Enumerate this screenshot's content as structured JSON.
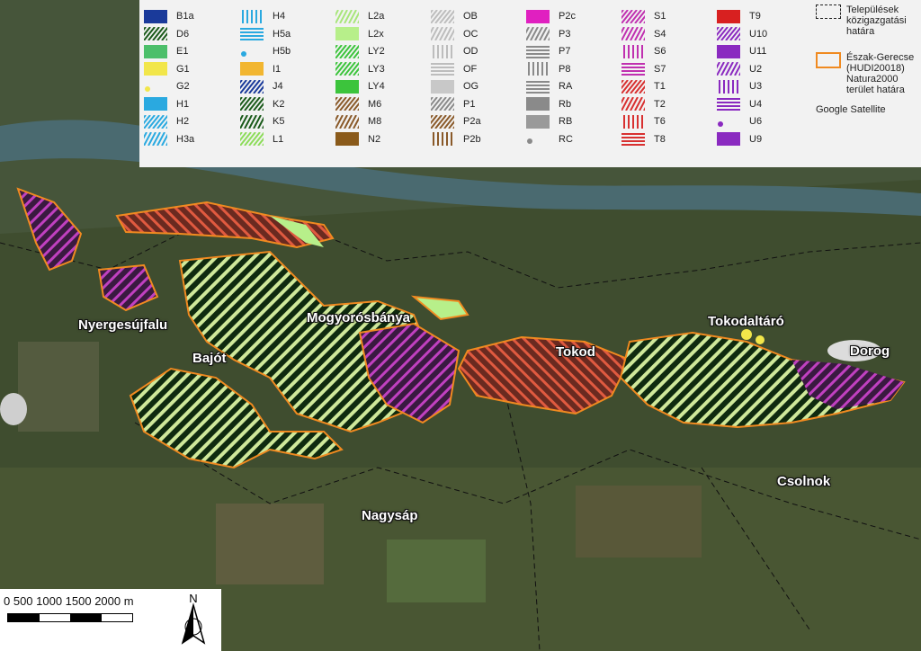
{
  "map": {
    "towns": [
      {
        "name": "Nyergesújfalu"
      },
      {
        "name": "Bajót"
      },
      {
        "name": "Mogyorósbánya"
      },
      {
        "name": "Tokod"
      },
      {
        "name": "Tokodaltáró"
      },
      {
        "name": "Dorog"
      },
      {
        "name": "Csolnok"
      },
      {
        "name": "Nagysáp"
      }
    ]
  },
  "legend": {
    "items": [
      {
        "code": "B1a",
        "fill": "#1a3a9a",
        "pattern": "solid"
      },
      {
        "code": "D6",
        "fill": "#1a5a1a",
        "pattern": "diag"
      },
      {
        "code": "E1",
        "fill": "#4cbf6a",
        "pattern": "solid"
      },
      {
        "code": "G1",
        "fill": "#f2e64a",
        "pattern": "solid"
      },
      {
        "code": "G2",
        "fill": "#f2e64a",
        "pattern": "dot"
      },
      {
        "code": "H1",
        "fill": "#2aa9e0",
        "pattern": "solid"
      },
      {
        "code": "H2",
        "fill": "#2aa9e0",
        "pattern": "diag"
      },
      {
        "code": "H3a",
        "fill": "#2aa9e0",
        "pattern": "diag2"
      },
      {
        "code": "H4",
        "fill": "#2aa9e0",
        "pattern": "vert"
      },
      {
        "code": "H5a",
        "fill": "#2aa9e0",
        "pattern": "horiz"
      },
      {
        "code": "H5b",
        "fill": "#2aa9e0",
        "pattern": "dot"
      },
      {
        "code": "I1",
        "fill": "#f2b630",
        "pattern": "solid"
      },
      {
        "code": "J4",
        "fill": "#1a3a9a",
        "pattern": "diag"
      },
      {
        "code": "K2",
        "fill": "#1a5a1a",
        "pattern": "diag"
      },
      {
        "code": "K5",
        "fill": "#1a5a1a",
        "pattern": "diag2"
      },
      {
        "code": "L1",
        "fill": "#8ddc5a",
        "pattern": "diag"
      },
      {
        "code": "L2a",
        "fill": "#a8e67a",
        "pattern": "diag2"
      },
      {
        "code": "L2x",
        "fill": "#b7ef8a",
        "pattern": "solid"
      },
      {
        "code": "LY2",
        "fill": "#3cc43c",
        "pattern": "diag"
      },
      {
        "code": "LY3",
        "fill": "#3cc43c",
        "pattern": "diag"
      },
      {
        "code": "LY4",
        "fill": "#3cc43c",
        "pattern": "solid"
      },
      {
        "code": "M6",
        "fill": "#8a5a2a",
        "pattern": "diag"
      },
      {
        "code": "M8",
        "fill": "#8a5a2a",
        "pattern": "diag2"
      },
      {
        "code": "N2",
        "fill": "#8a5a1a",
        "pattern": "solid"
      },
      {
        "code": "OB",
        "fill": "#bdbdbd",
        "pattern": "diag"
      },
      {
        "code": "OC",
        "fill": "#bdbdbd",
        "pattern": "diag2"
      },
      {
        "code": "OD",
        "fill": "#bdbdbd",
        "pattern": "vert"
      },
      {
        "code": "OF",
        "fill": "#bdbdbd",
        "pattern": "horiz"
      },
      {
        "code": "OG",
        "fill": "#c8c8c8",
        "pattern": "solid"
      },
      {
        "code": "P1",
        "fill": "#8a8a8a",
        "pattern": "diag"
      },
      {
        "code": "P2a",
        "fill": "#8a5a2a",
        "pattern": "diag"
      },
      {
        "code": "P2b",
        "fill": "#8a5a2a",
        "pattern": "vert"
      },
      {
        "code": "P2c",
        "fill": "#e020c0",
        "pattern": "solid"
      },
      {
        "code": "P3",
        "fill": "#8a8a8a",
        "pattern": "diag2"
      },
      {
        "code": "P7",
        "fill": "#8a8a8a",
        "pattern": "horiz"
      },
      {
        "code": "P8",
        "fill": "#8a8a8a",
        "pattern": "vert"
      },
      {
        "code": "RA",
        "fill": "#8a8a8a",
        "pattern": "horiz"
      },
      {
        "code": "Rb",
        "fill": "#8a8a8a",
        "pattern": "solid"
      },
      {
        "code": "RB",
        "fill": "#9a9a9a",
        "pattern": "solid"
      },
      {
        "code": "RC",
        "fill": "#8a8a8a",
        "pattern": "dot"
      },
      {
        "code": "S1",
        "fill": "#c030b0",
        "pattern": "diag"
      },
      {
        "code": "S4",
        "fill": "#c030b0",
        "pattern": "diag2"
      },
      {
        "code": "S6",
        "fill": "#c030b0",
        "pattern": "vert"
      },
      {
        "code": "S7",
        "fill": "#c030b0",
        "pattern": "horiz"
      },
      {
        "code": "T1",
        "fill": "#d83030",
        "pattern": "diag"
      },
      {
        "code": "T2",
        "fill": "#d83030",
        "pattern": "diag2"
      },
      {
        "code": "T6",
        "fill": "#d83030",
        "pattern": "vert"
      },
      {
        "code": "T8",
        "fill": "#d83030",
        "pattern": "horiz"
      },
      {
        "code": "T9",
        "fill": "#d82020",
        "pattern": "solid"
      },
      {
        "code": "U10",
        "fill": "#8a2ac0",
        "pattern": "diag"
      },
      {
        "code": "U11",
        "fill": "#8a2ac0",
        "pattern": "solid"
      },
      {
        "code": "U2",
        "fill": "#8a2ac0",
        "pattern": "diag2"
      },
      {
        "code": "U3",
        "fill": "#8a2ac0",
        "pattern": "vert"
      },
      {
        "code": "U4",
        "fill": "#8a2ac0",
        "pattern": "horiz"
      },
      {
        "code": "U6",
        "fill": "#8a2ac0",
        "pattern": "dot"
      },
      {
        "code": "U9",
        "fill": "#8a2ac0",
        "pattern": "solid"
      }
    ],
    "boundary_settlements": "Települések közigazgatási határa",
    "boundary_natura": "Észak-Gerecse (HUDI20018) Natura2000 terület határa",
    "basemap": "Google Satellite"
  },
  "scale": {
    "labels": "0   500  1000 1500 2000 m"
  },
  "north": {
    "label": "N"
  }
}
